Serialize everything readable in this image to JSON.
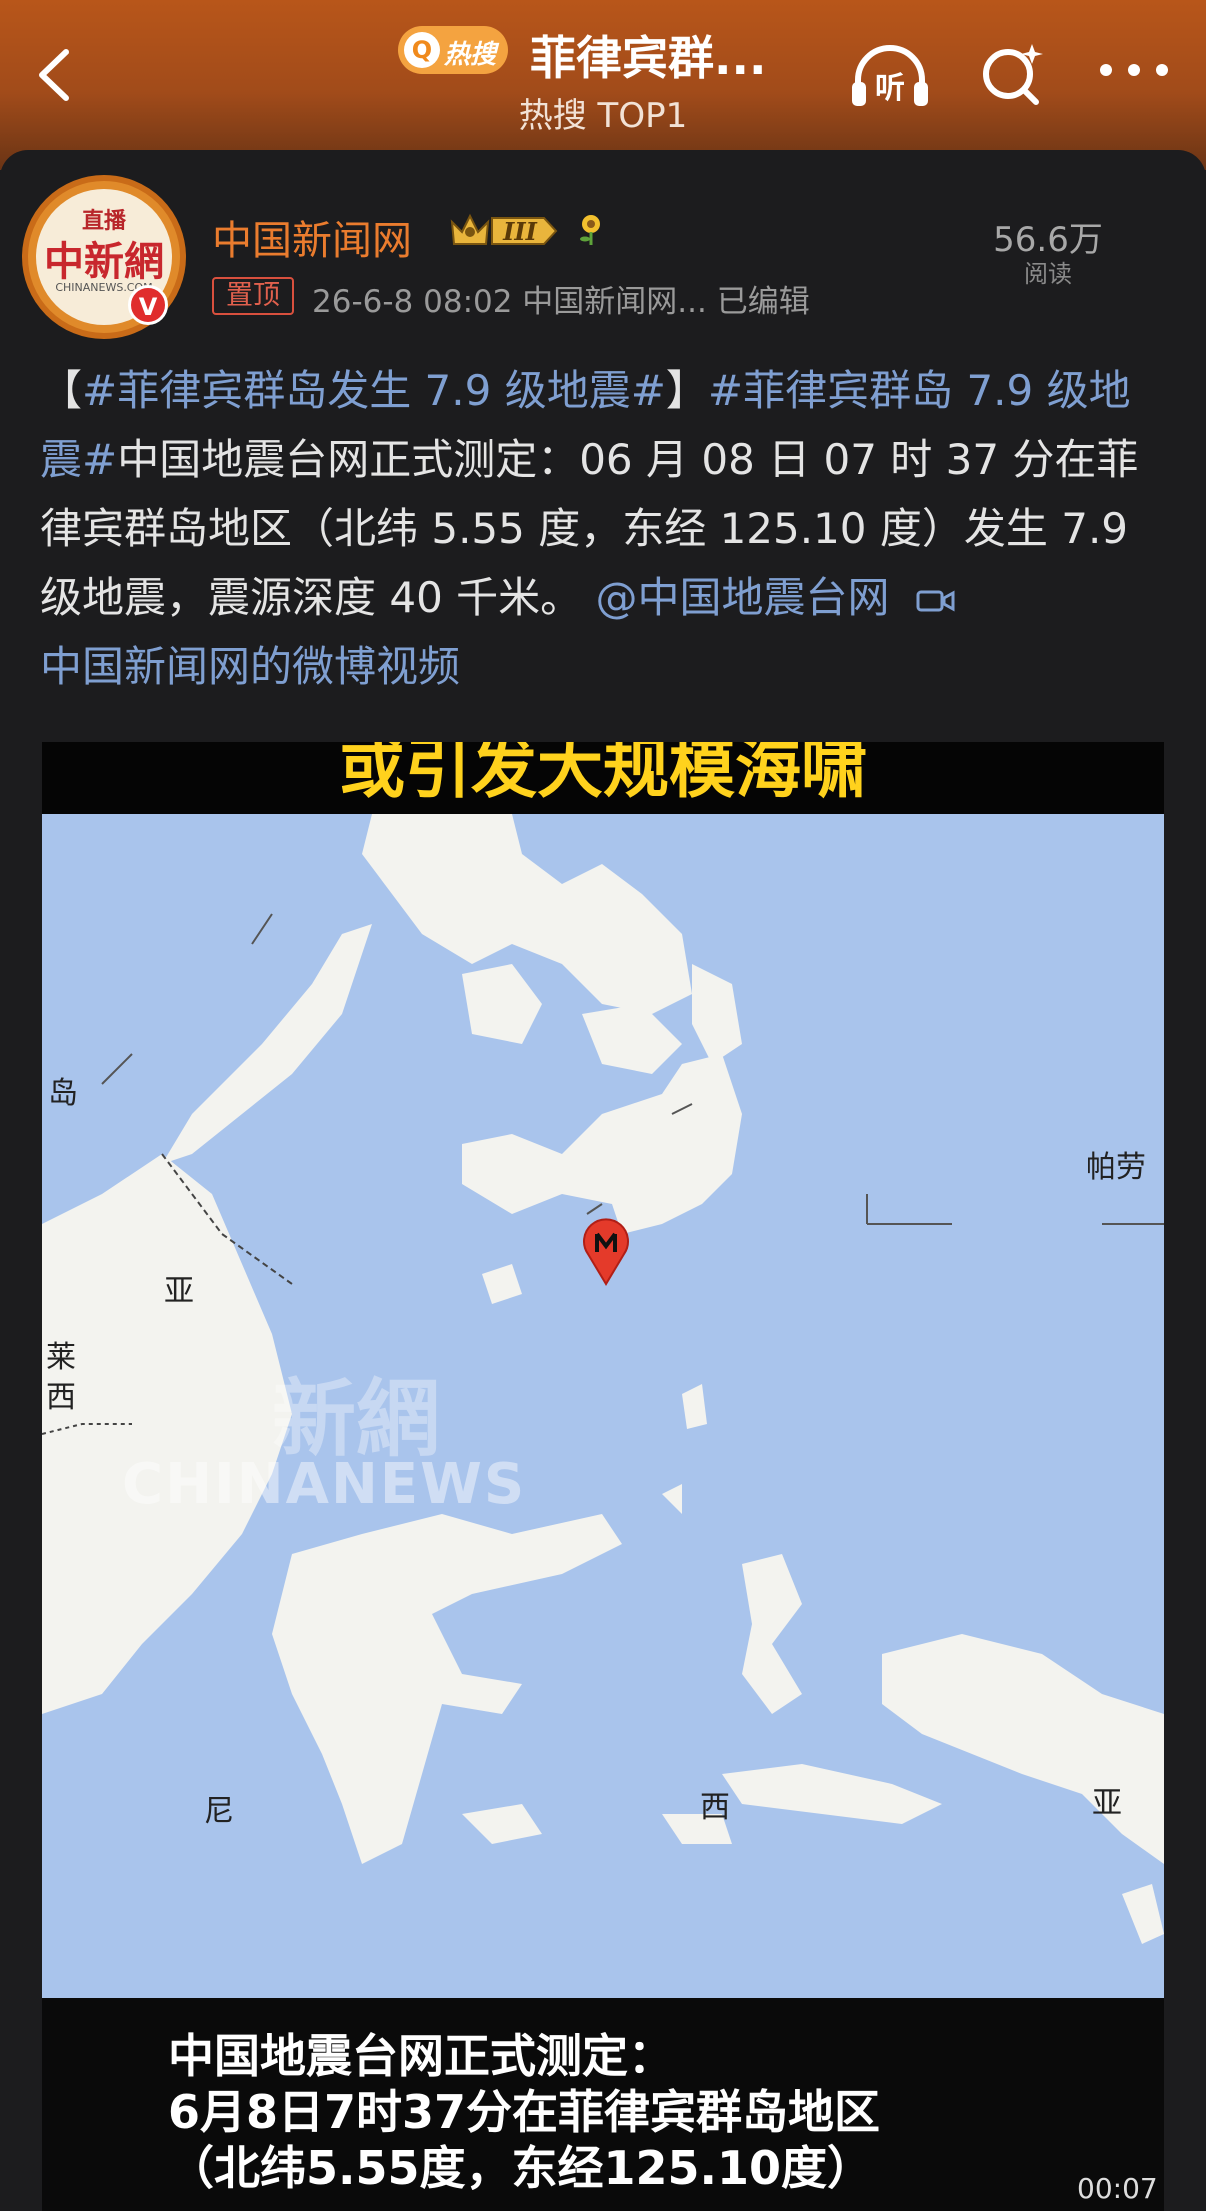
{
  "header": {
    "hot_badge": "热搜",
    "title": "菲律宾群...",
    "subtitle": "热搜 TOP1",
    "listen_label": "听"
  },
  "post": {
    "author": "中国新闻网",
    "level": "III",
    "pinned_label": "置顶",
    "meta": "26-6-8 08:02  中国新闻网...  已编辑",
    "read_count": "56.6万",
    "read_label": "阅读",
    "text": {
      "open_bracket": "【",
      "tag1": "#菲律宾群岛发生 7.9 级地震#",
      "close_bracket": "】",
      "tag2": "#菲律宾群岛 7.9 级地震#",
      "body": "中国地震台网正式测定：06 月 08 日 07 时 37 分在菲律宾群岛地区（北纬 5.55 度，东经 125.10 度）发生 7.9 级地震，震源深度 40 千米。",
      "mention": "@中国地震台网",
      "video_link": "中国新闻网的微博视频"
    }
  },
  "avatar": {
    "live": "直播",
    "logo": "中新網",
    "site": "CHINANEWS.COM",
    "verified": "V"
  },
  "video": {
    "banner": "或引发大规模海啸",
    "watermark_cn": "新網",
    "watermark_en": "CHINANEWS",
    "map_labels": {
      "dao": "岛",
      "ya1": "亚",
      "lai": "莱",
      "xi1": "西",
      "palau": "帕劳",
      "ni": "尼",
      "xi2": "西",
      "ya2": "亚"
    },
    "caption_lines": [
      "中国地震台网正式测定：",
      "6月8日7时37分在菲律宾群岛地区",
      "（北纬5.55度，东经125.10度）"
    ],
    "timecode": "00:07"
  },
  "colors": {
    "header_orange": "#b8561a",
    "author_orange": "#ea7c2e",
    "link_blue": "#7f9fd1",
    "banner_yellow": "#ffd21d",
    "sea_blue": "#a9c4ec",
    "land": "#f3f3ef"
  }
}
